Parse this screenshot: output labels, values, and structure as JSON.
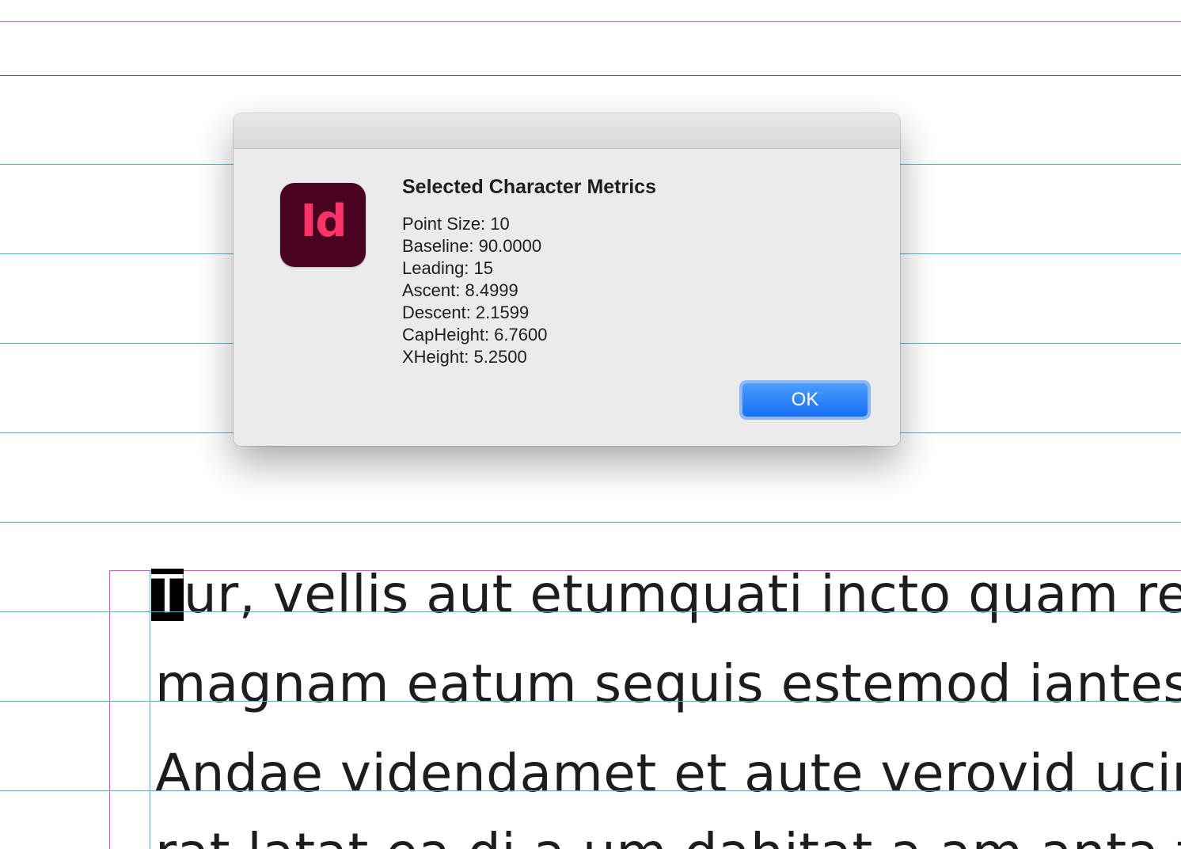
{
  "dialog": {
    "app_icon_label": "Id",
    "title": "Selected Character Metrics",
    "metrics": [
      "Point Size: 10",
      "Baseline: 90.0000",
      "Leading: 15",
      "Ascent: 8.4999",
      "Descent: 2.1599",
      "CapHeight: 6.7600",
      "XHeight: 5.2500"
    ],
    "ok_label": "OK"
  },
  "document": {
    "selected_char": "T",
    "line1_rest": "ur, vellis aut etumquati incto quam re",
    "line2": "magnam eatum sequis estemod iantest",
    "line3": "Andae videndamet et aute verovid ucim",
    "line4": "rat latat ea di a um dahitat a am anta ta"
  },
  "colors": {
    "margin_guide": "#d452d0",
    "baseline_grid": "#4ab7cf",
    "app_icon_bg": "#49021f",
    "app_icon_fg": "#ff3366",
    "ok_button": "#1670f3"
  }
}
